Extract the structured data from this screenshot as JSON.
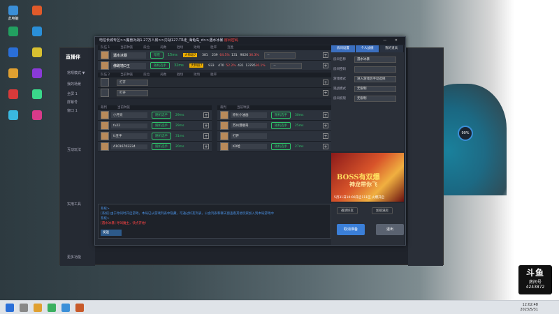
{
  "desktop": {
    "icons": [
      {
        "label": "此电脑",
        "color": "#3a8fd8"
      },
      {
        "label": "",
        "color": "#22a060"
      },
      {
        "label": "",
        "color": "#2a6fd8"
      },
      {
        "label": "",
        "color": "#e0a030"
      },
      {
        "label": "",
        "color": "#d83a3a"
      },
      {
        "label": "",
        "color": "#3ab8e0"
      },
      {
        "label": "",
        "color": "#e05a2a"
      },
      {
        "label": "",
        "color": "#2a8fd8"
      },
      {
        "label": "",
        "color": "#d8c030"
      },
      {
        "label": "",
        "color": "#8a3ad8"
      },
      {
        "label": "",
        "color": "#3ad88a"
      },
      {
        "label": "",
        "color": "#d83a8a"
      }
    ]
  },
  "background_app": {
    "logo": "直播伴",
    "nav": [
      "常规模式 ▼",
      "我的场景",
      "全屏 1",
      "屏幕号",
      "窗口 1",
      "互动玩法",
      "实用工具",
      "更多功能"
    ]
  },
  "gauge": {
    "value": "90%"
  },
  "window": {
    "title": "电信长城专区>>魔兽对战1.27万人房>>刃战127-TR走_海龟岛_d>>遇水冰暴",
    "title_badge": "房间密码",
    "team1_label": "队伍 1",
    "team2_label": "队伍 2",
    "columns": [
      "当前种族",
      "段位",
      "局数",
      "胜场",
      "败场",
      "胜率",
      "连胜"
    ],
    "team1": [
      {
        "name": "遇水冰暴",
        "race": "暗夜",
        "ping": "15ms",
        "rank": "大师段7",
        "c1": "381",
        "c2": "239",
        "rate": "64.5%",
        "c3": "131",
        "c4": "9026",
        "rate2": "36.3%",
        "sel": "--"
      },
      {
        "name": "佛跳墙O王",
        "race": "随机选手",
        "ping": "32ms",
        "rank": "大师段7",
        "c1": "933",
        "c2": "470",
        "rate": "52.2%",
        "c3": "431",
        "c4": "13785",
        "rate2": "36.1%",
        "sel": "--"
      }
    ],
    "team2": [
      {
        "sel": "打开"
      },
      {
        "sel": "打开"
      }
    ],
    "judges_label_left": "裁判",
    "judges_label_right": "裁判",
    "judges_left": [
      {
        "name": "小月亮",
        "race": "随机选手",
        "ping": "29ms"
      },
      {
        "name": "fu22",
        "race": "随机选手",
        "ping": "29ms"
      },
      {
        "name": "tt丑手",
        "race": "随机选手",
        "ping": "31ms"
      },
      {
        "name": "A1016702234",
        "race": "随机选手",
        "ping": "20ms"
      }
    ],
    "judges_right": [
      {
        "name": "原长小油画",
        "race": "随机选手",
        "ping": "30ms"
      },
      {
        "name": "苏州港顺哥",
        "race": "随机选手",
        "ping": "25ms"
      },
      {
        "name": "打开",
        "race": "",
        "ping": ""
      },
      {
        "name": "KO哈",
        "race": "随机选手",
        "ping": "27ms"
      }
    ],
    "chat": {
      "line0": "系统>",
      "line1": "[系统] 由于你同时开启游戏，本局已从游戏列表中隐藏，可通过好友列表，公会列表和聊天窗查看其他玩家加入到本局游戏中",
      "line2": "系统>",
      "line3": "[遇水冰暴] 呼叫魔主，快点开始!",
      "send_label": "发送"
    },
    "right_tabs": [
      "房间设置",
      "个人战绩",
      "我的道具"
    ],
    "settings": [
      {
        "label": "房间名称",
        "value": "遇水冰暴"
      },
      {
        "label": "房间密码",
        "value": ""
      },
      {
        "label": "游戏模式",
        "value": "进入游戏后手动选择"
      },
      {
        "label": "观战模式",
        "value": "无限制"
      },
      {
        "label": "房间权限",
        "value": "无限制"
      }
    ],
    "ad": {
      "title": "BOSS有双爆",
      "subtitle": "神龙带你飞",
      "date_text": "5月31日10:00开启111区 火爆开启"
    },
    "buttons": {
      "invite": "邀请好友",
      "kick": "加锁满房",
      "cancel": "取消准备",
      "exit": "退出"
    }
  },
  "taskbar": {
    "time": "12:02:48",
    "date": "2023/5/31"
  },
  "watermark": {
    "brand": "斗鱼",
    "sub": "房间号",
    "room": "4243872"
  }
}
